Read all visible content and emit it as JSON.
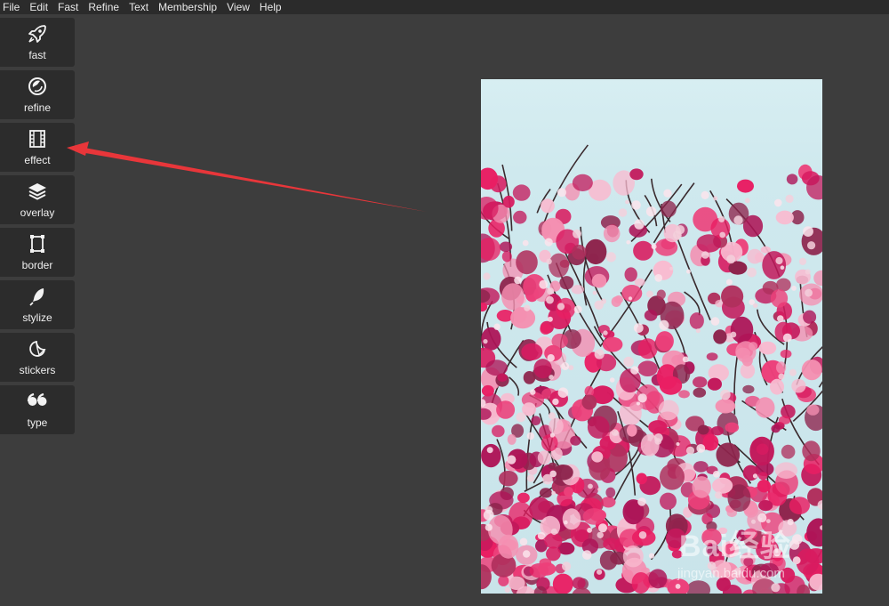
{
  "menubar": {
    "items": [
      "File",
      "Edit",
      "Fast",
      "Refine",
      "Text",
      "Membership",
      "View",
      "Help"
    ]
  },
  "toolbar": {
    "tools": [
      {
        "label": "fast",
        "icon": "rocket-icon"
      },
      {
        "label": "refine",
        "icon": "lens-icon"
      },
      {
        "label": "effect",
        "icon": "film-icon"
      },
      {
        "label": "overlay",
        "icon": "layers-icon"
      },
      {
        "label": "border",
        "icon": "frame-icon"
      },
      {
        "label": "stylize",
        "icon": "feather-icon"
      },
      {
        "label": "stickers",
        "icon": "sticker-icon"
      },
      {
        "label": "type",
        "icon": "quote-icon"
      }
    ]
  },
  "annotation": {
    "arrow_color": "#e8363a"
  },
  "photo": {
    "subject": "magnolia blossoms"
  },
  "watermark": {
    "main": "Bai经验",
    "sub": "jingyan.baidu.com"
  },
  "colors": {
    "background": "#3d3d3d",
    "menubar": "#2b2b2b",
    "tool_bg": "#2c2c2c",
    "text": "#efefef"
  }
}
